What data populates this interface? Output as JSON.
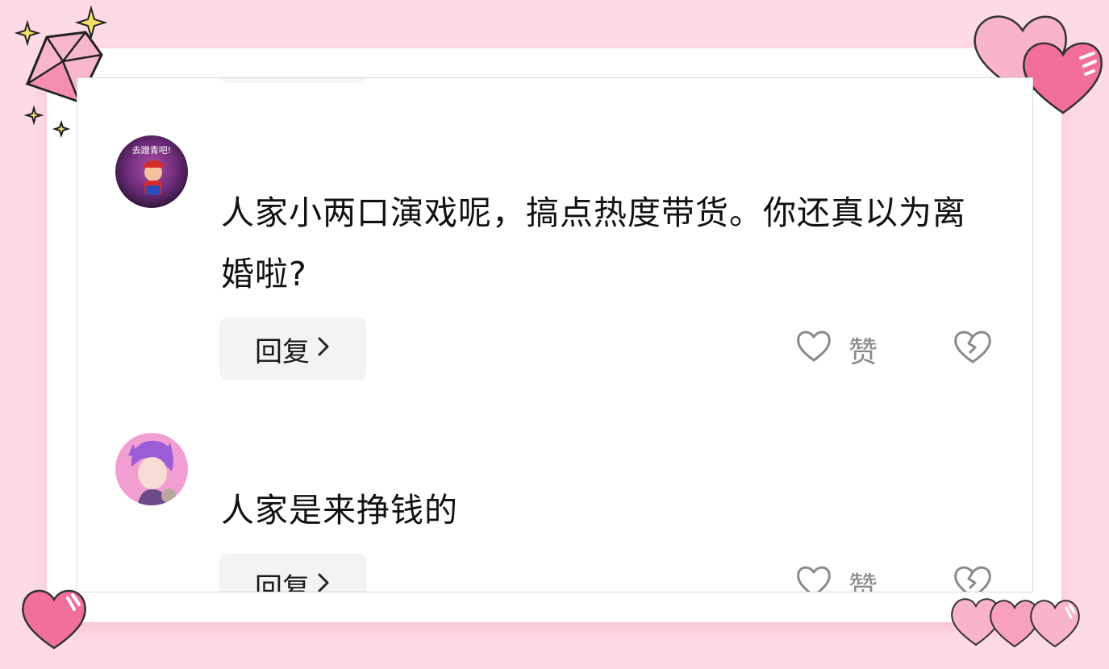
{
  "comments": [
    {
      "text": "人家小两口演戏呢，搞点热度带货。你还真以为离婚啦?",
      "avatar_text": "去蹭青吧!",
      "reply_label": "回复",
      "like_label": "赞"
    },
    {
      "text": "人家是来挣钱的",
      "reply_label": "回复",
      "like_label": "赞"
    }
  ],
  "icons": {
    "reply_chevron": "chevron-right-icon",
    "like": "heart-outline-icon",
    "dislike": "broken-heart-icon"
  },
  "colors": {
    "background": "#fddbe6",
    "card": "#ffffff",
    "button_bg": "#f3f3f5",
    "text": "#111111",
    "muted": "#8a8a8a",
    "heart_pink": "#f7a8c4"
  }
}
